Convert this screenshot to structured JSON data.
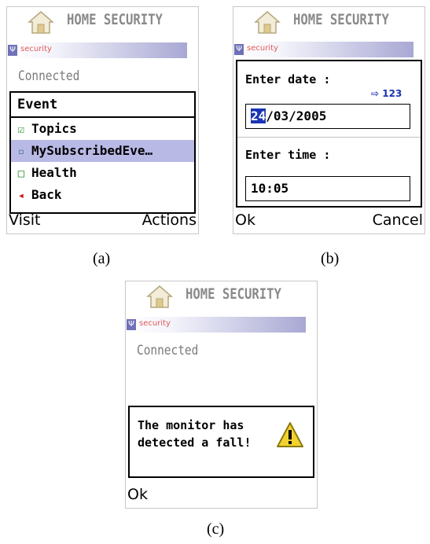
{
  "panels": {
    "a": {
      "app_title": "HOME SECURITY",
      "security_label": "security",
      "status": "Connected",
      "menu": {
        "header": "Event",
        "items": [
          {
            "label": "Topics",
            "icon": "checkbox-checked-icon"
          },
          {
            "label": "MySubscribedEve…",
            "icon": "square-icon"
          },
          {
            "label": "Health",
            "icon": "square-icon"
          },
          {
            "label": "Back",
            "icon": "back-arrow-icon"
          }
        ]
      },
      "softkey_left": "Visit",
      "softkey_right": "Actions",
      "caption": "(a)"
    },
    "b": {
      "app_title": "HOME SECURITY",
      "security_label": "security",
      "date_label": "Enter date :",
      "input_mode": "123",
      "date_day": "24",
      "date_rest": "/03/2005",
      "time_label": "Enter time :",
      "time_value": "10:05",
      "softkey_left": "Ok",
      "softkey_right": "Cancel",
      "caption": "(b)"
    },
    "c": {
      "app_title": "HOME SECURITY",
      "security_label": "security",
      "status": "Connected",
      "alert_message": "The monitor has detected a fall!",
      "softkey_left": "Ok",
      "caption": "(c)"
    }
  },
  "colors": {
    "selection": "#b9b9e6",
    "highlight": "#1a34b4",
    "title_gray": "#8a8a8a",
    "security_red": "#e05a5a",
    "warning_yellow": "#f2d230"
  }
}
